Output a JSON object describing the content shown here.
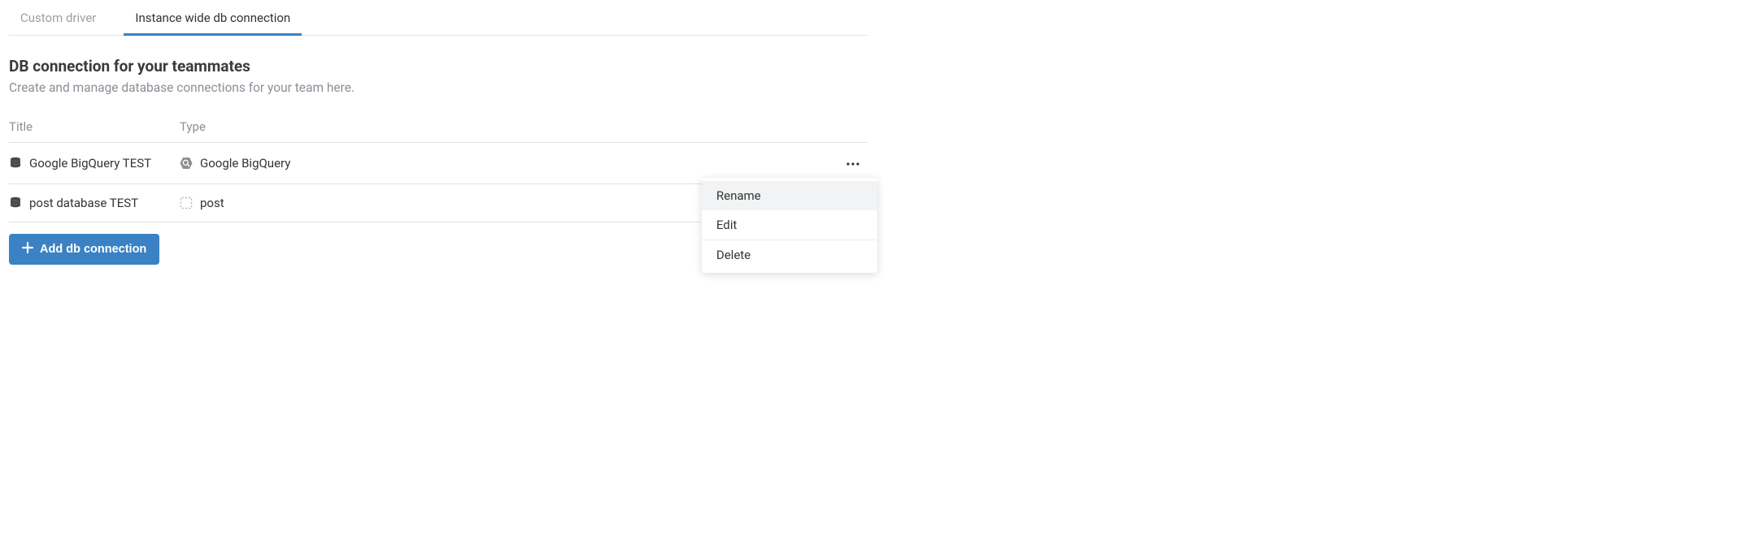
{
  "tabs": {
    "custom_driver": "Custom driver",
    "instance_wide": "Instance wide db connection"
  },
  "section": {
    "title": "DB connection for your teammates",
    "subtitle": "Create and manage database connections for your team here."
  },
  "columns": {
    "title": "Title",
    "type": "Type"
  },
  "rows": [
    {
      "title": "Google BigQuery TEST",
      "type": "Google BigQuery",
      "type_icon": "bigquery"
    },
    {
      "title": "post database TEST",
      "type": "post",
      "type_icon": "generic"
    }
  ],
  "add_button": "Add db connection",
  "menu": {
    "rename": "Rename",
    "edit": "Edit",
    "delete": "Delete"
  }
}
